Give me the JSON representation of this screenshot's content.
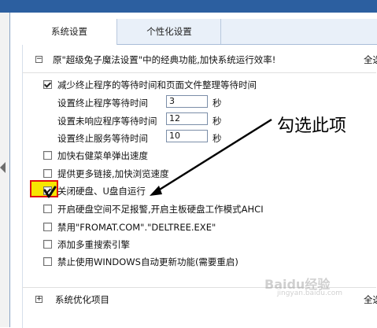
{
  "tabs": [
    {
      "label": "系统设置",
      "active": true
    },
    {
      "label": "个性化设置",
      "active": false
    }
  ],
  "section_top": {
    "expander": "−",
    "description": "原\"超级兔子魔法设置\"中的经典功能,加快系统运行效率!",
    "select_all": "全选"
  },
  "options": [
    {
      "label": "减少终止程序的等待时间和页面文件整理等待时间",
      "checked": true
    },
    {
      "label": "加快右健菜单弹出速度",
      "checked": false
    },
    {
      "label": "提供更多链接,加快浏览速度",
      "checked": false
    },
    {
      "label": "关闭硬盘、U盘自运行",
      "checked": true
    },
    {
      "label": "开启硬盘空间不足报警,开启主板硬盘工作模式AHCI",
      "checked": false
    },
    {
      "label": "禁用\"FROMAT.COM\".\"DELTREE.EXE\"",
      "checked": false
    },
    {
      "label": "添加多重搜索引擎",
      "checked": false
    },
    {
      "label": "禁止使用WINDOWS自动更新功能(需要重启)",
      "checked": false
    }
  ],
  "wait_settings": [
    {
      "label": "设置终止程序等待时间",
      "value": "3",
      "unit": "秒"
    },
    {
      "label": "设置未响应程序等待时间",
      "value": "12",
      "unit": "秒"
    },
    {
      "label": "设置终止服务等待时间",
      "value": "10",
      "unit": "秒"
    }
  ],
  "section_bottom": {
    "expander": "+",
    "label": "系统优化项目",
    "select_all": "全选"
  },
  "annotation": "勾选此项",
  "colors": {
    "highlight": "#f7e600",
    "highlight_border": "#e01010",
    "annotation": "#000000"
  },
  "watermark": {
    "brand": "Baidu经验",
    "url": "jingyan.baidu.com"
  }
}
